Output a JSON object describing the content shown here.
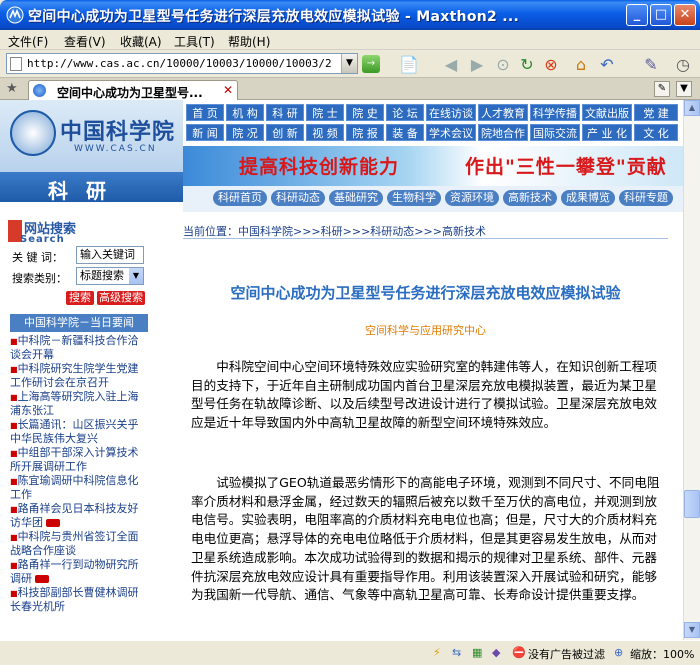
{
  "window": {
    "title": "空间中心成功为卫星型号任务进行深层充放电效应模拟试验 - Maxthon2 ...",
    "minimize": "_",
    "maximize": "□",
    "close": "✕"
  },
  "menu": [
    "文件(F)",
    "查看(V)",
    "收藏(A)",
    "工具(T)",
    "帮助(H)"
  ],
  "address": {
    "url": "http://www.cas.ac.cn/10000/10003/10000/10003/2009/13"
  },
  "tab": {
    "label": "空间中心成功为卫星型号..."
  },
  "site": {
    "logo_cn": "中国科学院",
    "logo_en": "WWW.CAS.CN",
    "section": "科研",
    "nav_row1": [
      "首 页",
      "机 构",
      "科 研",
      "院 士",
      "院 史",
      "论 坛",
      "在线访谈",
      "人才教育",
      "科学传播",
      "文献出版",
      "党 建"
    ],
    "nav_row2": [
      "新 闻",
      "院 况",
      "创 新",
      "视 频",
      "院 报",
      "装 备",
      "学术会议",
      "院地合作",
      "国际交流",
      "产 业 化",
      "文 化"
    ],
    "banner_left": "提高科技创新能力",
    "banner_right": "作出\"三性一攀登\"贡献",
    "subnav": [
      "科研首页",
      "科研动态",
      "基础研究",
      "生物科学",
      "资源环境",
      "高新技术",
      "成果博览",
      "科研专题"
    ]
  },
  "sidebar": {
    "search_title": "网站搜索",
    "search_sub": "Search",
    "keyword_label": "关 键 词：",
    "keyword_value": "输入关键词",
    "category_label": "搜索类别：",
    "category_value": "标题搜索",
    "search_button": "搜索",
    "advanced_button": "高级搜索",
    "news_head": "中国科学院－当日要闻",
    "news": [
      "中科院－新疆科技合作洽谈会开幕",
      "中科院研究生院学生党建工作研讨会在京召开",
      "上海高等研究院入驻上海浦东张江",
      "长篇通讯：山区振兴关乎中华民族伟大复兴",
      "中组部干部深入计算技术所开展调研工作",
      "陈宜瑜调研中科院信息化工作",
      "路甬祥会见日本科技友好访华团",
      "中科院与贵州省签订全面战略合作座谈",
      "路甬祥一行到动物研究所调研",
      "科技部副部长曹健林调研长春光机所"
    ]
  },
  "article": {
    "breadcrumb": "当前位置：中国科学院>>>科研>>>科研动态>>>高新技术",
    "title": "空间中心成功为卫星型号任务进行深层充放电效应模拟试验",
    "source": "空间科学与应用研究中心",
    "para1": "中科院空间中心空间环境特殊效应实验研究室的韩建伟等人，在知识创新工程项目的支持下，于近年自主研制成功国内首台卫星深层充放电模拟装置，最近为某卫星型号任务在轨故障诊断、以及后续型号改进设计进行了模拟试验。卫星深层充放电效应是近十年导致国内外中高轨卫星故障的新型空间环境特殊效应。",
    "para2": "试验模拟了GEO轨道最恶劣情形下的高能电子环境，观测到不同尺寸、不同电阻率介质材料和悬浮金属，经过数天的辐照后被充以数千至万伏的高电位，并观测到放电信号。实验表明，电阻率高的介质材料充电电位也高；但是，尺寸大的介质材料充电电位更高；悬浮导体的充电电位略低于介质材料，但是其更容易发生放电，从而对卫星系统造成影响。本次成功试验得到的数据和揭示的规律对卫星系统、部件、元器件抗深层充放电效应设计具有重要指导作用。利用该装置深入开展试验和研究，能够为我国新一代导航、通信、气象等中高轨卫星高可靠、长寿命设计提供重要支撑。"
  },
  "status": {
    "adblock": "没有广告被过滤",
    "zoom": "缩放：100%"
  }
}
